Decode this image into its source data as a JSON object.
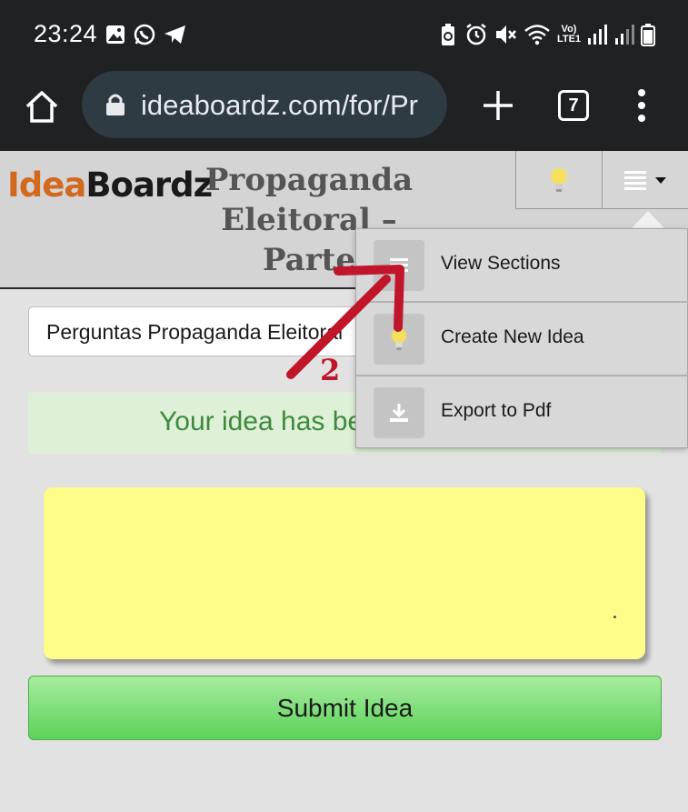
{
  "status_bar": {
    "time": "23:24",
    "network_label_top": "Vo)",
    "network_label_bottom": "LTE1"
  },
  "browser": {
    "url": "ideaboardz.com/for/Pr",
    "tab_count": "7"
  },
  "site": {
    "logo_part1": "Idea",
    "logo_part2": "Boardz",
    "title_line1": "Propaganda",
    "title_line2": "Eleitoral –",
    "title_line3": "Parte"
  },
  "menu": {
    "items": [
      {
        "label": "View Sections",
        "icon": "list-icon"
      },
      {
        "label": "Create New Idea",
        "icon": "lightbulb-icon"
      },
      {
        "label": "Export to Pdf",
        "icon": "download-icon"
      }
    ]
  },
  "section_select": {
    "value": "Perguntas Propaganda Eleitoral"
  },
  "alert": {
    "text": "Your idea has been"
  },
  "idea_form": {
    "text": "",
    "submit_label": "Submit Idea"
  },
  "annotation": {
    "number": "2"
  },
  "colors": {
    "logo_orange": "#d2691e",
    "note_yellow": "#fdfd87",
    "submit_green": "#5cd25a",
    "annotation_red": "#c0152a"
  }
}
